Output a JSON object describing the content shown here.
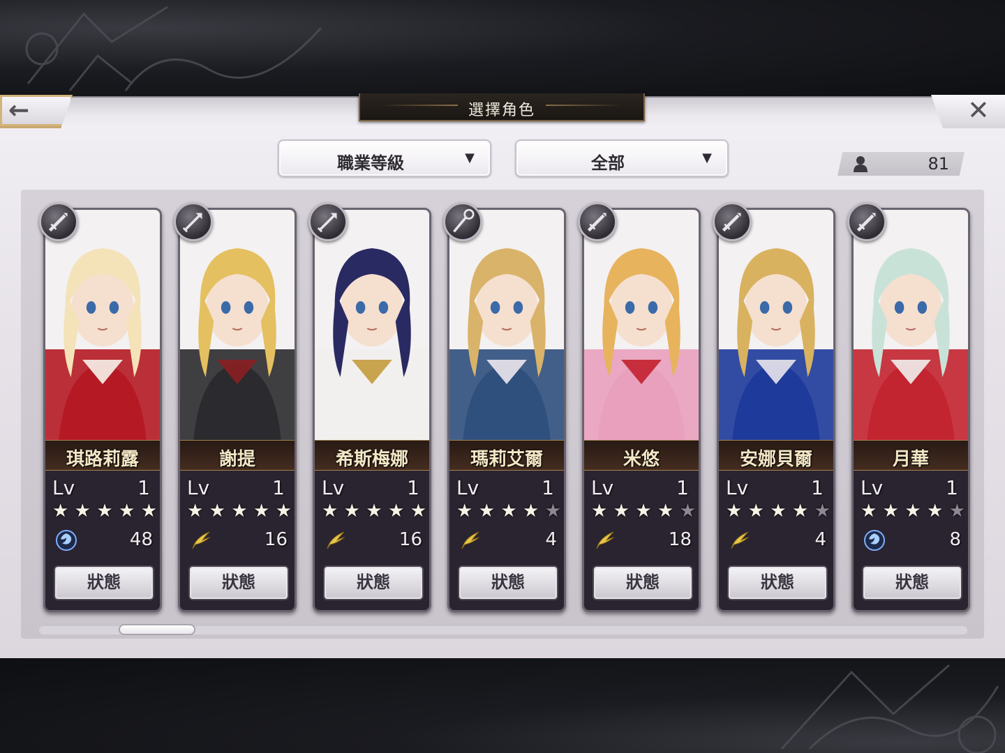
{
  "header": {
    "title": "選擇角色",
    "back_icon": "back-arrow-icon",
    "close_icon": "close-icon"
  },
  "filters": {
    "sort": {
      "label": "職業等級"
    },
    "category": {
      "label": "全部"
    }
  },
  "unit_count": "81",
  "colors": {
    "panel": "#e7e3e9",
    "name_plate": "#3a2619",
    "name_text": "#f4e7c6",
    "accent_gold": "#c8a870"
  },
  "status_label": "狀態",
  "lv_label": "Lv",
  "characters": [
    {
      "name": "琪路莉露",
      "level": "1",
      "stars": 5,
      "element": "water",
      "element_value": "48",
      "class_icon": "sword-icon",
      "palette": [
        "#f4e3b9",
        "#b51a24",
        "#f7f2ea"
      ]
    },
    {
      "name": "謝提",
      "level": "1",
      "stars": 5,
      "element": "wind",
      "element_value": "16",
      "class_icon": "arrow-icon",
      "palette": [
        "#e4c060",
        "#2b2a2e",
        "#8a1f22"
      ]
    },
    {
      "name": "希斯梅娜",
      "level": "1",
      "stars": 5,
      "element": "wind",
      "element_value": "16",
      "class_icon": "arrow-icon",
      "palette": [
        "#2a2a62",
        "#f2f0ee",
        "#c49b3c"
      ]
    },
    {
      "name": "瑪莉艾爾",
      "level": "1",
      "stars": 4,
      "element": "wind",
      "element_value": "4",
      "class_icon": "staff-icon",
      "palette": [
        "#d9b36a",
        "#2f4f7d",
        "#ece7ee"
      ]
    },
    {
      "name": "米悠",
      "level": "1",
      "stars": 4,
      "element": "wind",
      "element_value": "18",
      "class_icon": "sword-icon",
      "palette": [
        "#e7b35d",
        "#e9a0bd",
        "#c3202e"
      ]
    },
    {
      "name": "安娜貝爾",
      "level": "1",
      "stars": 4,
      "element": "wind",
      "element_value": "4",
      "class_icon": "sword-icon",
      "palette": [
        "#d9b260",
        "#1e3a9a",
        "#e8e6ec"
      ]
    },
    {
      "name": "月華",
      "level": "1",
      "stars": 4,
      "element": "water",
      "element_value": "8",
      "class_icon": "sword-icon",
      "palette": [
        "#c9e2d8",
        "#c22430",
        "#f2f0ee"
      ]
    }
  ]
}
